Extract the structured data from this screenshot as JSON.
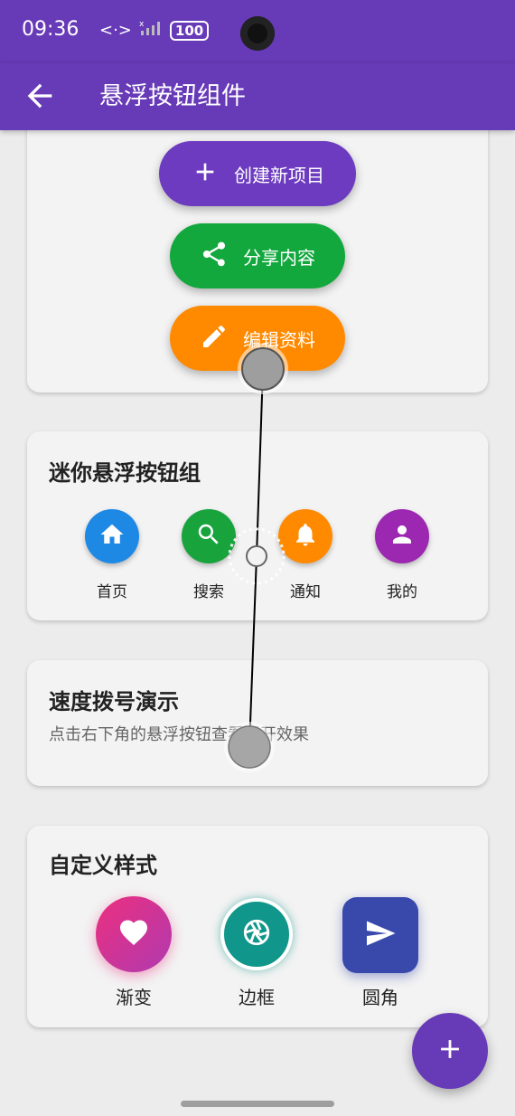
{
  "status_bar": {
    "time": "09:36",
    "battery": "100"
  },
  "app_bar": {
    "title": "悬浮按钮组件"
  },
  "extended_fabs": [
    {
      "label": "创建新项目",
      "color": "#6c3bbf",
      "icon": "plus-icon"
    },
    {
      "label": "分享内容",
      "color": "#13a83e",
      "icon": "share-icon"
    },
    {
      "label": "编辑资料",
      "color": "#ff8a00",
      "icon": "pencil-icon"
    }
  ],
  "mini_section": {
    "title": "迷你悬浮按钮组",
    "items": [
      {
        "label": "首页",
        "color": "#1e88e5",
        "icon": "home-icon"
      },
      {
        "label": "搜索",
        "color": "#18a33d",
        "icon": "search-icon"
      },
      {
        "label": "通知",
        "color": "#ff8a00",
        "icon": "bell-icon"
      },
      {
        "label": "我的",
        "color": "#9c27b0",
        "icon": "person-icon"
      }
    ]
  },
  "speed_dial": {
    "title": "速度拨号演示",
    "subtitle": "点击右下角的悬浮按钮查看展开效果"
  },
  "custom_section": {
    "title": "自定义样式",
    "items": [
      {
        "label": "渐变",
        "icon": "heart-icon"
      },
      {
        "label": "边框",
        "icon": "aperture-icon",
        "color": "#10968a"
      },
      {
        "label": "圆角",
        "icon": "send-icon",
        "color": "#3949ab"
      }
    ]
  },
  "fab": {
    "icon": "plus-icon",
    "color": "#673ab7"
  }
}
